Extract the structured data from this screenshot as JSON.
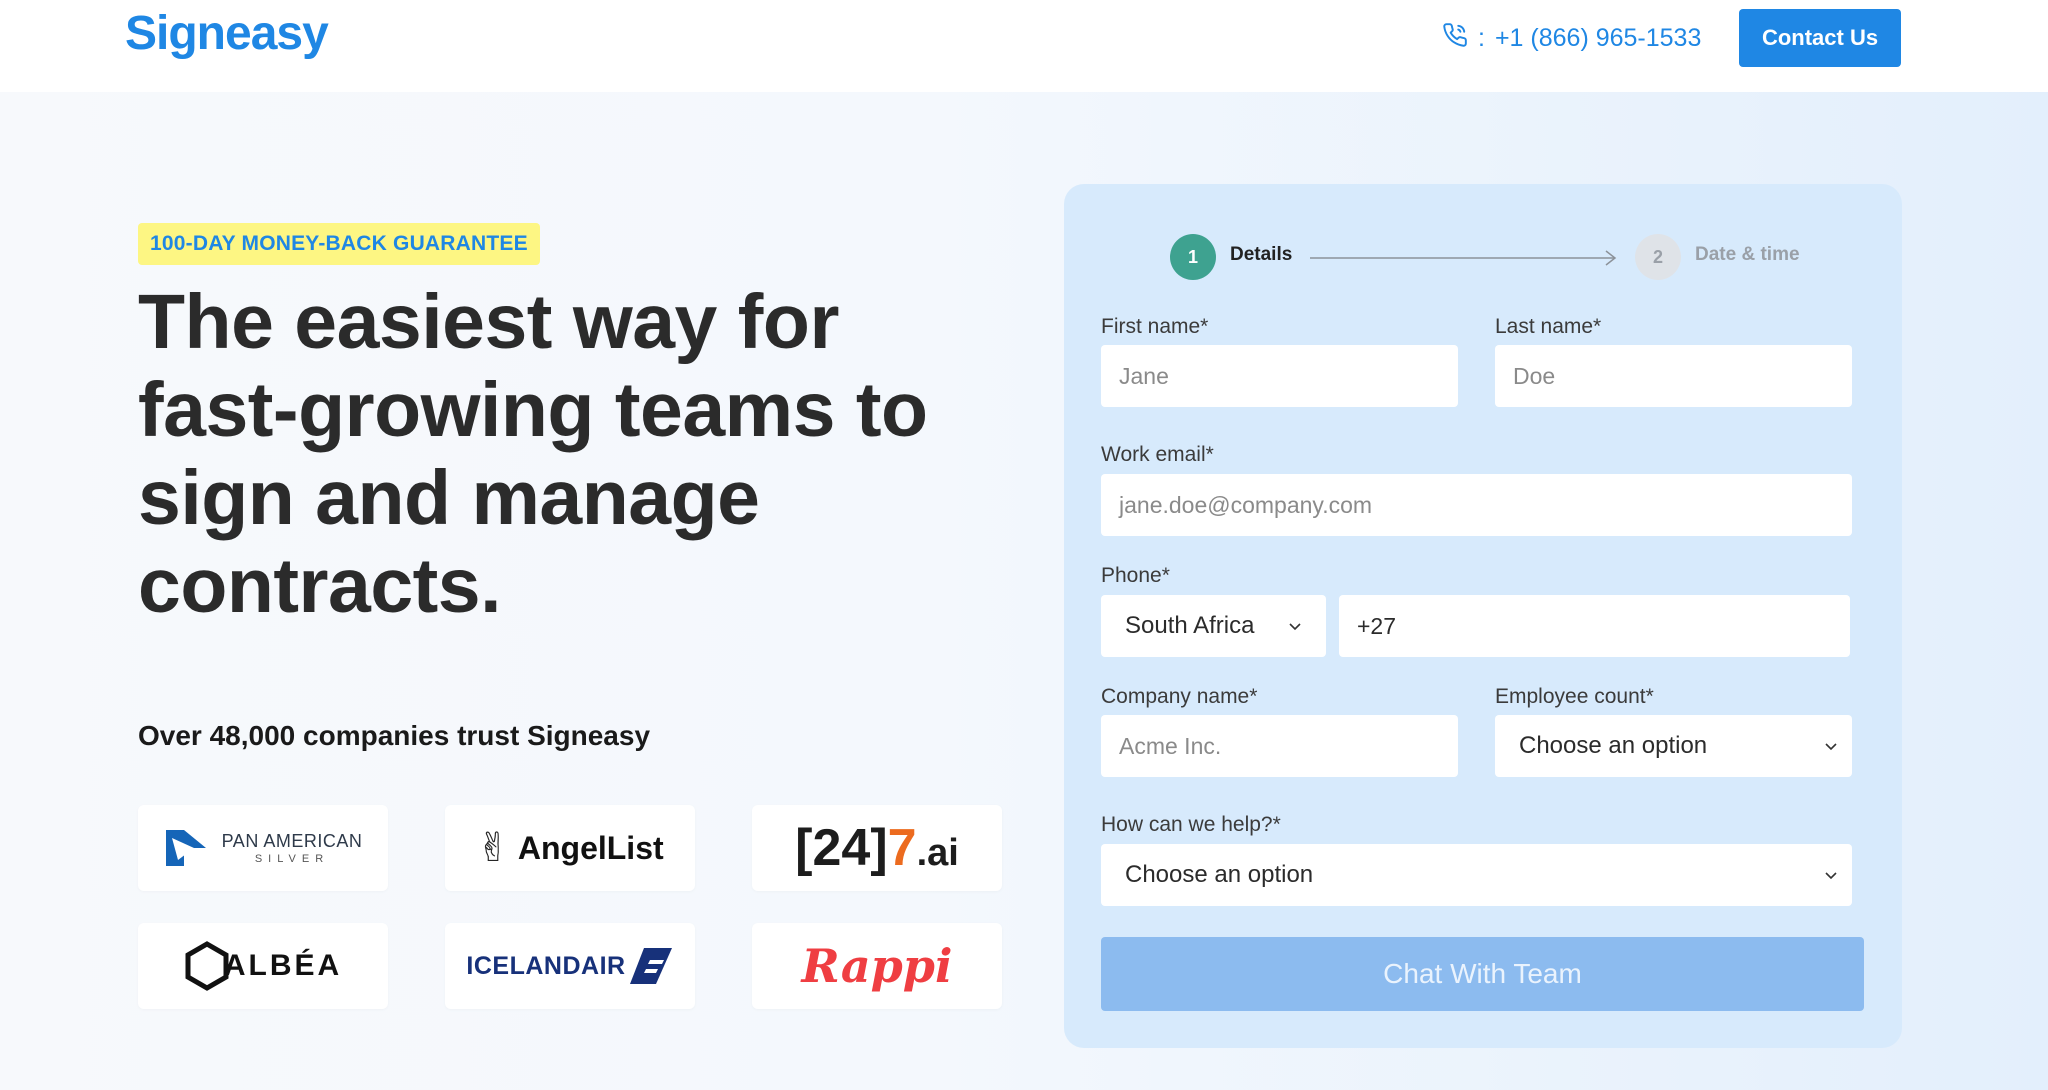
{
  "brand": {
    "name": "Signeasy",
    "accent": "#1f87e4"
  },
  "header": {
    "phone_prefix": ":",
    "phone_number": "+1 (866) 965-1533",
    "contact_button": "Contact Us"
  },
  "hero": {
    "badge": "100-DAY MONEY-BACK GUARANTEE",
    "headline": "The easiest way for fast-growing teams to sign and manage contracts.",
    "trust_text": "Over 48,000 companies trust Signeasy",
    "logos": [
      {
        "name": "PAN AMERICAN",
        "sub": "SILVER"
      },
      {
        "name": "AngelList"
      },
      {
        "name_a": "[24]",
        "name_b": "7",
        "name_c": ".ai"
      },
      {
        "name": "ALBÉA"
      },
      {
        "name": "ICELANDAIR"
      },
      {
        "name": "Rappi"
      }
    ]
  },
  "form": {
    "steps": [
      {
        "number": "1",
        "label": "Details"
      },
      {
        "number": "2",
        "label": "Date & time"
      }
    ],
    "first_name": {
      "label": "First name*",
      "placeholder": "Jane"
    },
    "last_name": {
      "label": "Last name*",
      "placeholder": "Doe"
    },
    "work_email": {
      "label": "Work email*",
      "placeholder": "jane.doe@company.com"
    },
    "phone": {
      "label": "Phone*",
      "country": "South Africa",
      "code": "+27"
    },
    "company_name": {
      "label": "Company name*",
      "placeholder": "Acme Inc."
    },
    "employee_count": {
      "label": "Employee count*",
      "value": "Choose an option"
    },
    "help": {
      "label": "How can we help?*",
      "value": "Choose an option"
    },
    "submit": "Chat With Team"
  }
}
